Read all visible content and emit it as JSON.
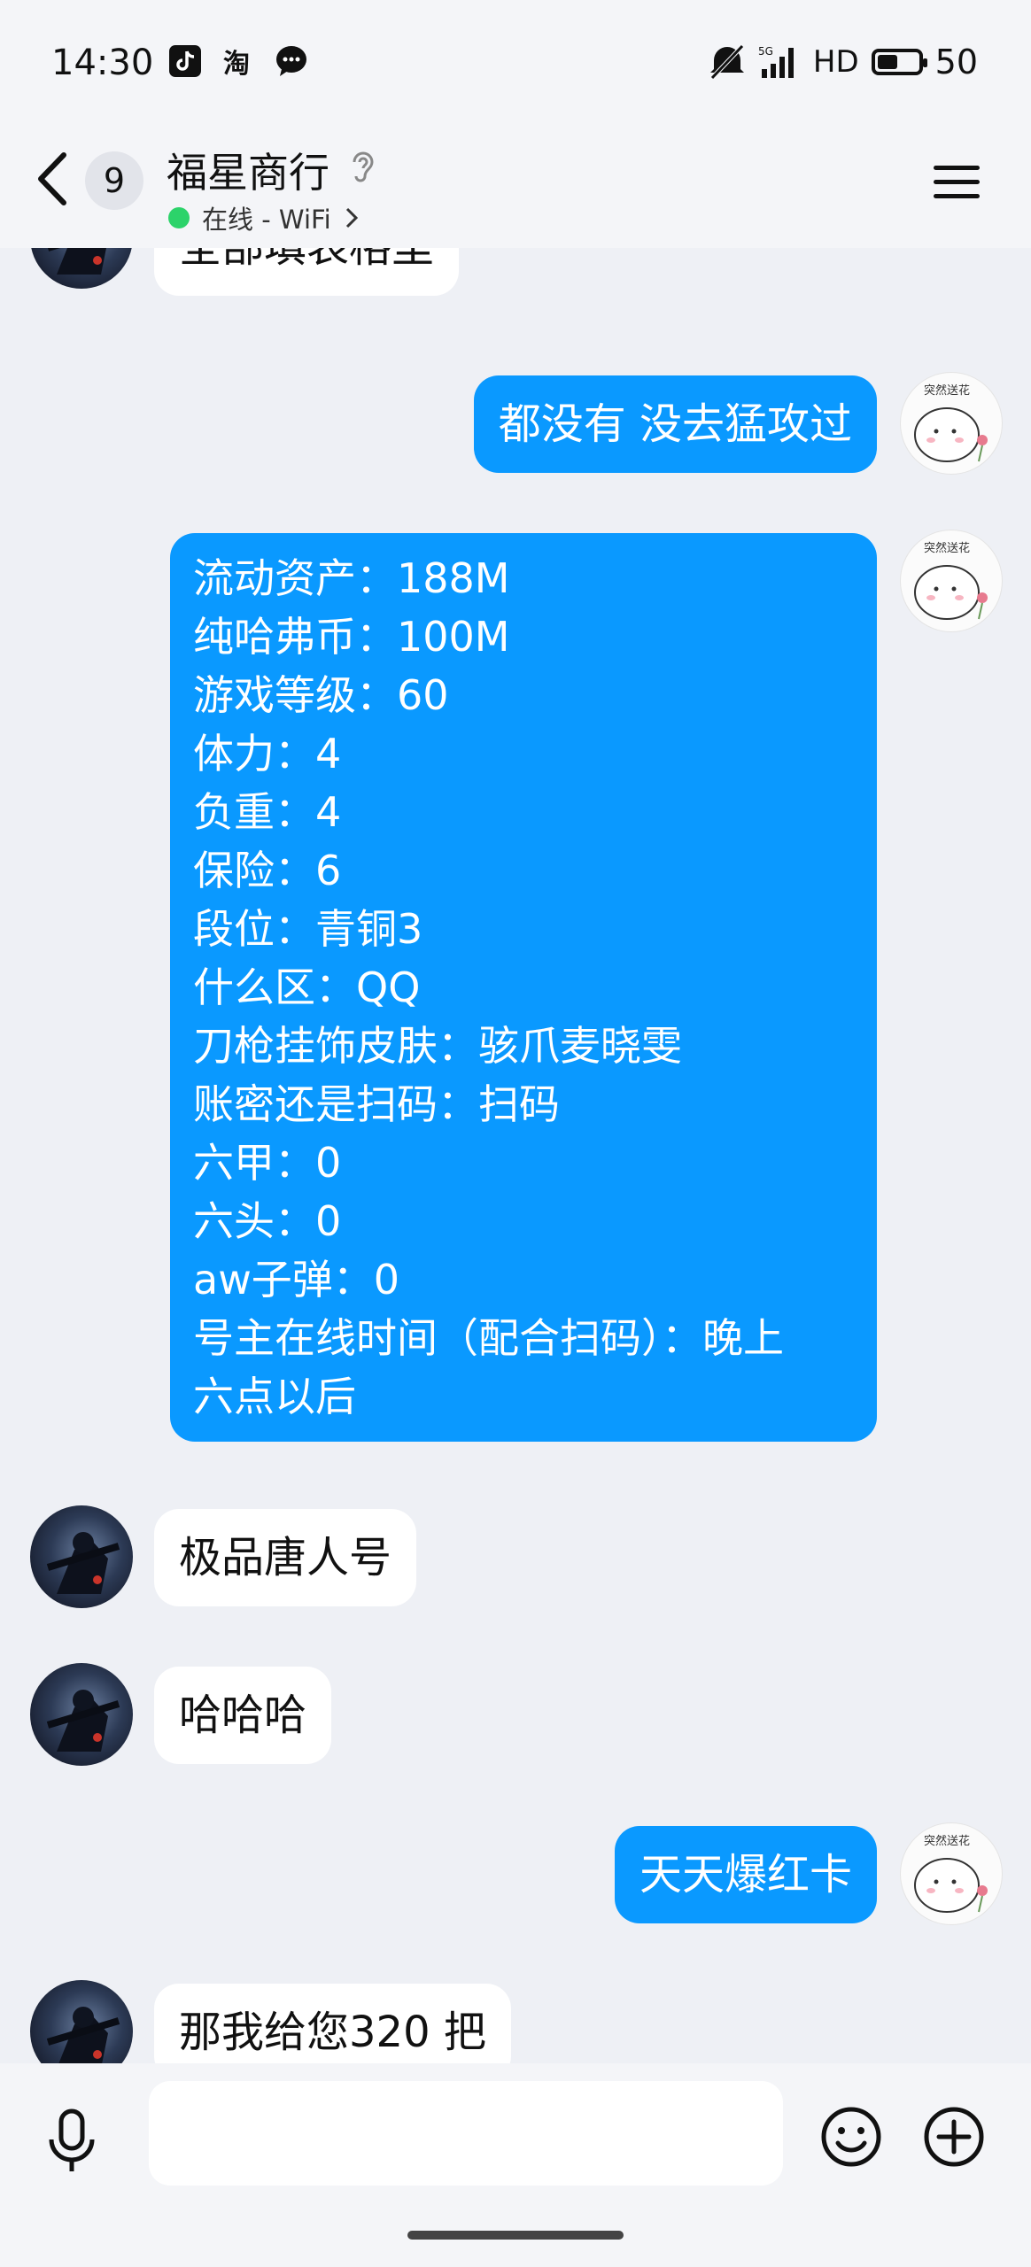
{
  "status_bar": {
    "time": "14:30",
    "app_icons": [
      "tiktok-icon",
      "taobao-icon",
      "chat-app-icon"
    ],
    "network": "5G",
    "hd": "HD",
    "battery": "50"
  },
  "header": {
    "unread_count": "9",
    "title": "福星商行",
    "status": "在线 - WiFi"
  },
  "messages": [
    {
      "from": "other",
      "text": "全部填表格里"
    },
    {
      "from": "self",
      "text": "都没有 没去猛攻过"
    },
    {
      "from": "self",
      "lines": [
        "流动资产：188M",
        "纯哈弗币：100M",
        "游戏等级：60",
        "体力：4",
        "负重：4",
        "保险：6",
        "段位：青铜3",
        "什么区：QQ",
        "刀枪挂饰皮肤：骇爪麦晓雯",
        "账密还是扫码：扫码",
        "六甲：0",
        "六头：0",
        "aw子弹：0",
        "号主在线时间（配合扫码）：晚上",
        "六点以后"
      ]
    },
    {
      "from": "other",
      "text": "极品唐人号"
    },
    {
      "from": "other",
      "text": "哈哈哈"
    },
    {
      "from": "self",
      "text": "天天爆红卡"
    },
    {
      "from": "other",
      "text": "那我给您320 把"
    }
  ],
  "self_avatar_caption": "突然送花",
  "input": {
    "placeholder": ""
  },
  "colors": {
    "outgoing_bubble": "#0a99ff",
    "incoming_bubble": "#ffffff",
    "background": "#eef0f5",
    "online": "#2cd36a"
  }
}
